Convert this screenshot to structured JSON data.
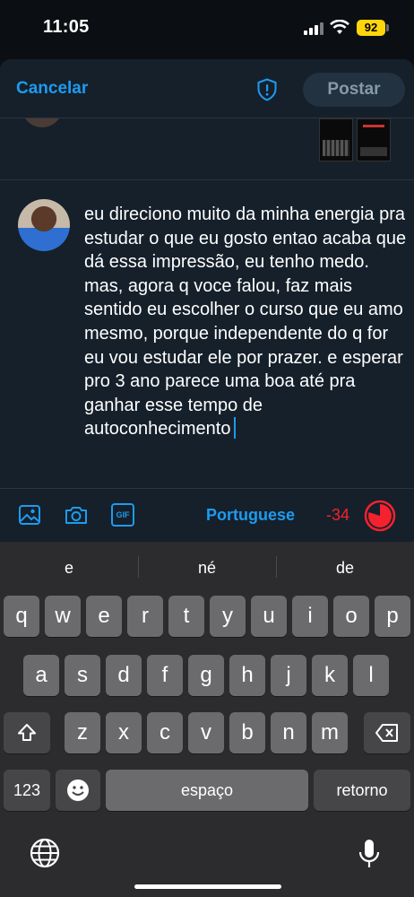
{
  "status_bar": {
    "time": "11:05",
    "battery": "92"
  },
  "compose": {
    "cancel_label": "Cancelar",
    "post_label": "Postar",
    "tweet_text": "eu direciono muito da minha energia pra estudar o que eu gosto entao acaba que dá essa impressão, eu tenho medo. mas, agora q voce falou, faz mais sentido eu escolher o curso que eu amo mesmo, porque independente do q for eu vou estudar ele por prazer. e esperar pro 3 ano parece uma boa até pra ganhar esse tempo de autoconhecimento",
    "toolbar": {
      "language": "Portuguese",
      "char_count": "-34",
      "gif_label": "GIF"
    }
  },
  "keyboard": {
    "suggestions": [
      "e",
      "né",
      "de"
    ],
    "row1": [
      "q",
      "w",
      "e",
      "r",
      "t",
      "y",
      "u",
      "i",
      "o",
      "p"
    ],
    "row2": [
      "a",
      "s",
      "d",
      "f",
      "g",
      "h",
      "j",
      "k",
      "l"
    ],
    "row3": [
      "z",
      "x",
      "c",
      "v",
      "b",
      "n",
      "m"
    ],
    "numbers_label": "123",
    "space_label": "espaço",
    "return_label": "retorno"
  },
  "colors": {
    "accent": "#1d9bf0",
    "danger": "#f4212e",
    "battery": "#ffd60a",
    "sheet_bg": "#15202b",
    "keyboard_bg": "#2c2c2e"
  },
  "icons": [
    "shield-icon",
    "image-icon",
    "camera-icon",
    "gif-icon",
    "progress-ring-icon",
    "shift-icon",
    "backspace-icon",
    "emoji-icon",
    "globe-icon",
    "microphone-icon"
  ]
}
